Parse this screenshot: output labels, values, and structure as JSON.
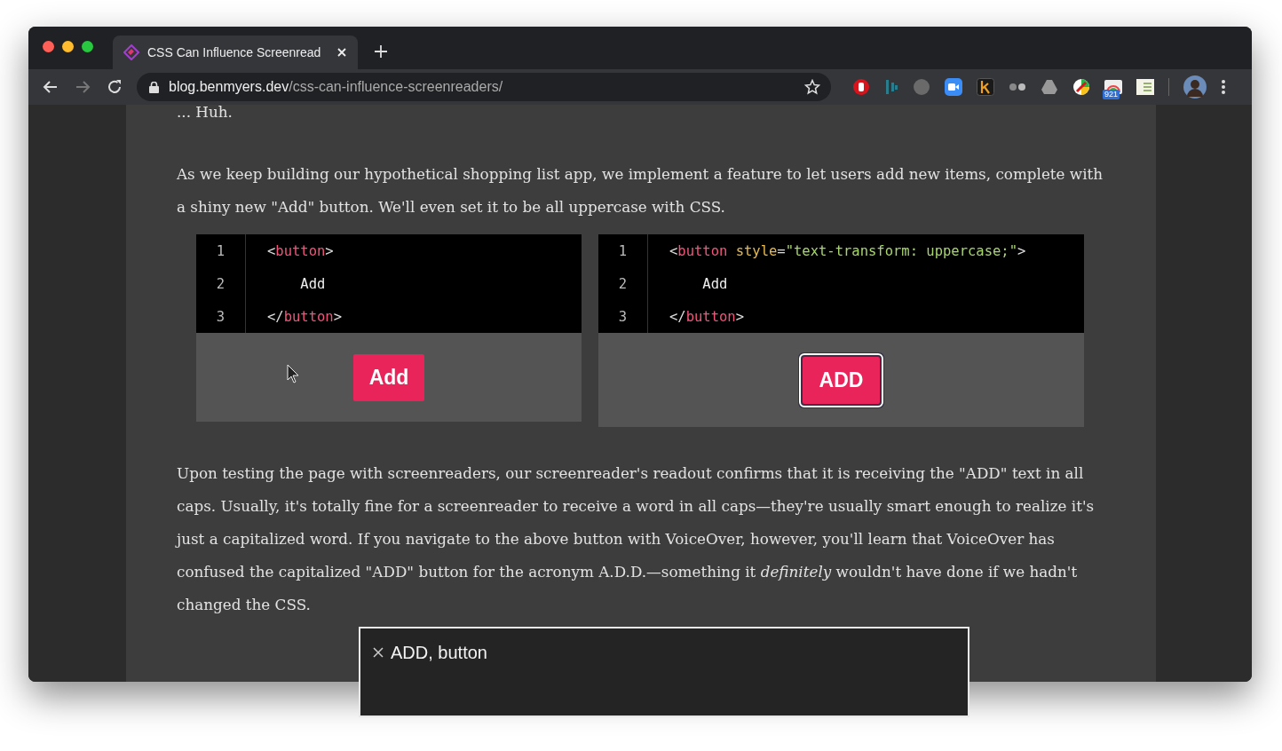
{
  "browser": {
    "tab": {
      "title": "CSS Can Influence Screenread",
      "selected": true
    },
    "address": {
      "host": "blog.benmyers.dev",
      "path": "/css-can-influence-screenreaders/"
    },
    "extension_badge": "921"
  },
  "article": {
    "paragraphs": [
      "... Huh.",
      "As we keep building our hypothetical shopping list app, we implement a feature to let users add new items, complete with a shiny new \"Add\" button. We'll even set it to be all uppercase with CSS."
    ],
    "examples": [
      {
        "lines": [
          {
            "number": "1",
            "tokens": [
              {
                "kind": "punct",
                "text": "<"
              },
              {
                "kind": "tag",
                "text": "button"
              },
              {
                "kind": "punct",
                "text": ">"
              }
            ]
          },
          {
            "number": "2",
            "tokens": [
              {
                "kind": "text",
                "text": "    Add"
              }
            ]
          },
          {
            "number": "3",
            "tokens": [
              {
                "kind": "punct",
                "text": "</"
              },
              {
                "kind": "tag",
                "text": "button"
              },
              {
                "kind": "punct",
                "text": ">"
              }
            ]
          }
        ],
        "button": {
          "label": "Add",
          "focused": false
        }
      },
      {
        "lines": [
          {
            "number": "1",
            "tokens": [
              {
                "kind": "punct",
                "text": "<"
              },
              {
                "kind": "tag",
                "text": "button"
              },
              {
                "kind": "attr",
                "text": " style"
              },
              {
                "kind": "punct",
                "text": "="
              },
              {
                "kind": "string",
                "text": "\"text-transform: uppercase;\""
              },
              {
                "kind": "punct",
                "text": ">"
              }
            ]
          },
          {
            "number": "2",
            "tokens": [
              {
                "kind": "text",
                "text": "    Add"
              }
            ]
          },
          {
            "number": "3",
            "tokens": [
              {
                "kind": "punct",
                "text": "</"
              },
              {
                "kind": "tag",
                "text": "button"
              },
              {
                "kind": "punct",
                "text": ">"
              }
            ]
          }
        ],
        "button": {
          "label": "ADD",
          "focused": true
        }
      }
    ],
    "after": "Upon testing the page with screenreaders, our screenreader's readout confirms that it is receiving the \"ADD\" text in all caps. Usually, it's totally fine for a screenreader to receive a word in all caps—they're usually smart enough to realize it's just a capitalized word. If you navigate to the above button with VoiceOver, however, you'll learn that VoiceOver has confused the capitalized \"ADD\" button for the acronym A.D.D.—something it *definitely* wouldn't have done if we hadn't changed the CSS."
  },
  "voiceover_caption": {
    "text": "ADD, button"
  }
}
